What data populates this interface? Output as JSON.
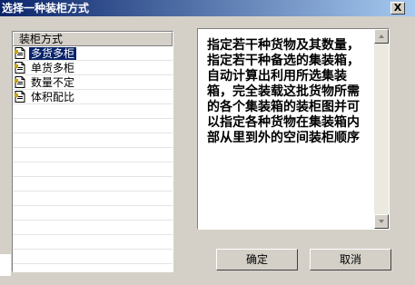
{
  "window": {
    "title": "选择一种装柜方式",
    "close_glyph": "X"
  },
  "list": {
    "header": "装柜方式",
    "items": [
      {
        "label": "多货多柜",
        "icon": "document-icon",
        "selected": true
      },
      {
        "label": "单货多柜",
        "icon": "document-icon",
        "selected": false
      },
      {
        "label": "数量不定",
        "icon": "document-icon",
        "selected": false
      },
      {
        "label": "体积配比",
        "icon": "document-icon",
        "selected": false
      }
    ]
  },
  "description": {
    "text": "指定若干种货物及其数量，指定若干种备选的集装箱，自动计算出利用所选集装箱，完全装载这批货物所需的各个集装箱的装柜图并可以指定各种货物在集装箱内部从里到外的空间装柜顺序"
  },
  "buttons": {
    "ok": "确定",
    "cancel": "取消"
  },
  "colors": {
    "titlebar_start": "#0a246a",
    "titlebar_end": "#a6caf0",
    "face": "#d4d0c8",
    "selection": "#0a246a"
  }
}
